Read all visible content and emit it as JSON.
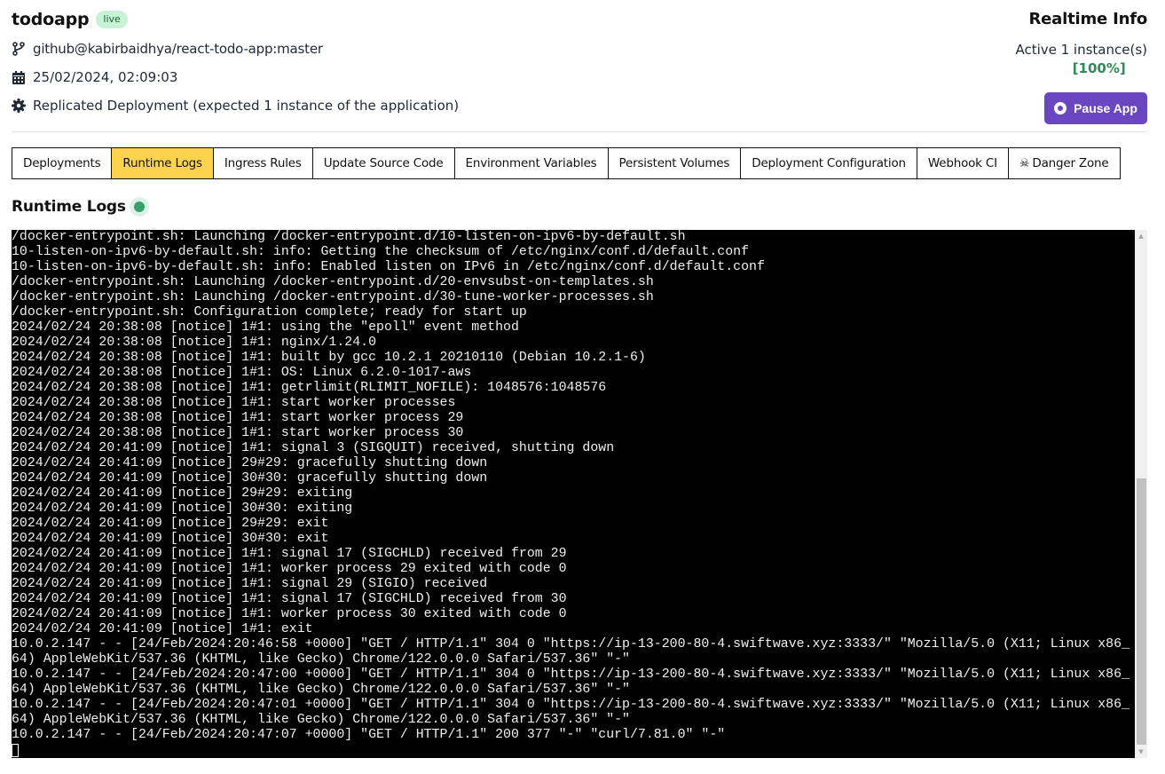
{
  "app": {
    "name": "todoapp",
    "status_badge": "live",
    "source": "github@kabirbaidhya/react-todo-app:master",
    "deployed_at": "25/02/2024, 02:09:03",
    "deployment_mode": "Replicated Deployment (expected 1 instance of the application)"
  },
  "icons": {
    "source": "git-branch-icon",
    "date": "calendar-icon",
    "mode": "gear-icon",
    "pause": "stop-circle-icon",
    "danger": "skull-crossbones-icon"
  },
  "realtime": {
    "title": "Realtime Info",
    "active_text": "Active 1 instance(s)",
    "active_percent": "[100%]",
    "pause_button": "Pause App"
  },
  "colors": {
    "accent_purple": "#6b46c1",
    "active_tab": "#fcd34d",
    "live_green": "#38a169",
    "badge_bg": "#c8f2d5",
    "percent_green": "#2e8b57"
  },
  "tabs": [
    {
      "label": "Deployments",
      "active": false
    },
    {
      "label": "Runtime Logs",
      "active": true
    },
    {
      "label": "Ingress Rules",
      "active": false
    },
    {
      "label": "Update Source Code",
      "active": false
    },
    {
      "label": "Environment Variables",
      "active": false
    },
    {
      "label": "Persistent Volumes",
      "active": false
    },
    {
      "label": "Deployment Configuration",
      "active": false
    },
    {
      "label": "Webhook CI",
      "active": false
    },
    {
      "label": "Danger Zone",
      "active": false,
      "icon": "skull-crossbones-icon"
    }
  ],
  "logs": {
    "title": "Runtime Logs",
    "scroll_position_percent": 100,
    "lines": [
      "/docker-entrypoint.sh: Launching /docker-entrypoint.d/10-listen-on-ipv6-by-default.sh",
      "10-listen-on-ipv6-by-default.sh: info: Getting the checksum of /etc/nginx/conf.d/default.conf",
      "10-listen-on-ipv6-by-default.sh: info: Enabled listen on IPv6 in /etc/nginx/conf.d/default.conf",
      "/docker-entrypoint.sh: Launching /docker-entrypoint.d/20-envsubst-on-templates.sh",
      "/docker-entrypoint.sh: Launching /docker-entrypoint.d/30-tune-worker-processes.sh",
      "/docker-entrypoint.sh: Configuration complete; ready for start up",
      "2024/02/24 20:38:08 [notice] 1#1: using the \"epoll\" event method",
      "2024/02/24 20:38:08 [notice] 1#1: nginx/1.24.0",
      "2024/02/24 20:38:08 [notice] 1#1: built by gcc 10.2.1 20210110 (Debian 10.2.1-6)",
      "2024/02/24 20:38:08 [notice] 1#1: OS: Linux 6.2.0-1017-aws",
      "2024/02/24 20:38:08 [notice] 1#1: getrlimit(RLIMIT_NOFILE): 1048576:1048576",
      "2024/02/24 20:38:08 [notice] 1#1: start worker processes",
      "2024/02/24 20:38:08 [notice] 1#1: start worker process 29",
      "2024/02/24 20:38:08 [notice] 1#1: start worker process 30",
      "2024/02/24 20:41:09 [notice] 1#1: signal 3 (SIGQUIT) received, shutting down",
      "2024/02/24 20:41:09 [notice] 29#29: gracefully shutting down",
      "2024/02/24 20:41:09 [notice] 30#30: gracefully shutting down",
      "2024/02/24 20:41:09 [notice] 29#29: exiting",
      "2024/02/24 20:41:09 [notice] 30#30: exiting",
      "2024/02/24 20:41:09 [notice] 29#29: exit",
      "2024/02/24 20:41:09 [notice] 30#30: exit",
      "2024/02/24 20:41:09 [notice] 1#1: signal 17 (SIGCHLD) received from 29",
      "2024/02/24 20:41:09 [notice] 1#1: worker process 29 exited with code 0",
      "2024/02/24 20:41:09 [notice] 1#1: signal 29 (SIGIO) received",
      "2024/02/24 20:41:09 [notice] 1#1: signal 17 (SIGCHLD) received from 30",
      "2024/02/24 20:41:09 [notice] 1#1: worker process 30 exited with code 0",
      "2024/02/24 20:41:09 [notice] 1#1: exit",
      "10.0.2.147 - - [24/Feb/2024:20:46:58 +0000] \"GET / HTTP/1.1\" 304 0 \"https://ip-13-200-80-4.swiftwave.xyz:3333/\" \"Mozilla/5.0 (X11; Linux x86_64) AppleWebKit/537.36 (KHTML, like Gecko) Chrome/122.0.0.0 Safari/537.36\" \"-\"",
      "10.0.2.147 - - [24/Feb/2024:20:47:00 +0000] \"GET / HTTP/1.1\" 304 0 \"https://ip-13-200-80-4.swiftwave.xyz:3333/\" \"Mozilla/5.0 (X11; Linux x86_64) AppleWebKit/537.36 (KHTML, like Gecko) Chrome/122.0.0.0 Safari/537.36\" \"-\"",
      "10.0.2.147 - - [24/Feb/2024:20:47:01 +0000] \"GET / HTTP/1.1\" 304 0 \"https://ip-13-200-80-4.swiftwave.xyz:3333/\" \"Mozilla/5.0 (X11; Linux x86_64) AppleWebKit/537.36 (KHTML, like Gecko) Chrome/122.0.0.0 Safari/537.36\" \"-\"",
      "10.0.2.147 - - [24/Feb/2024:20:47:07 +0000] \"GET / HTTP/1.1\" 200 377 \"-\" \"curl/7.81.0\" \"-\""
    ]
  }
}
